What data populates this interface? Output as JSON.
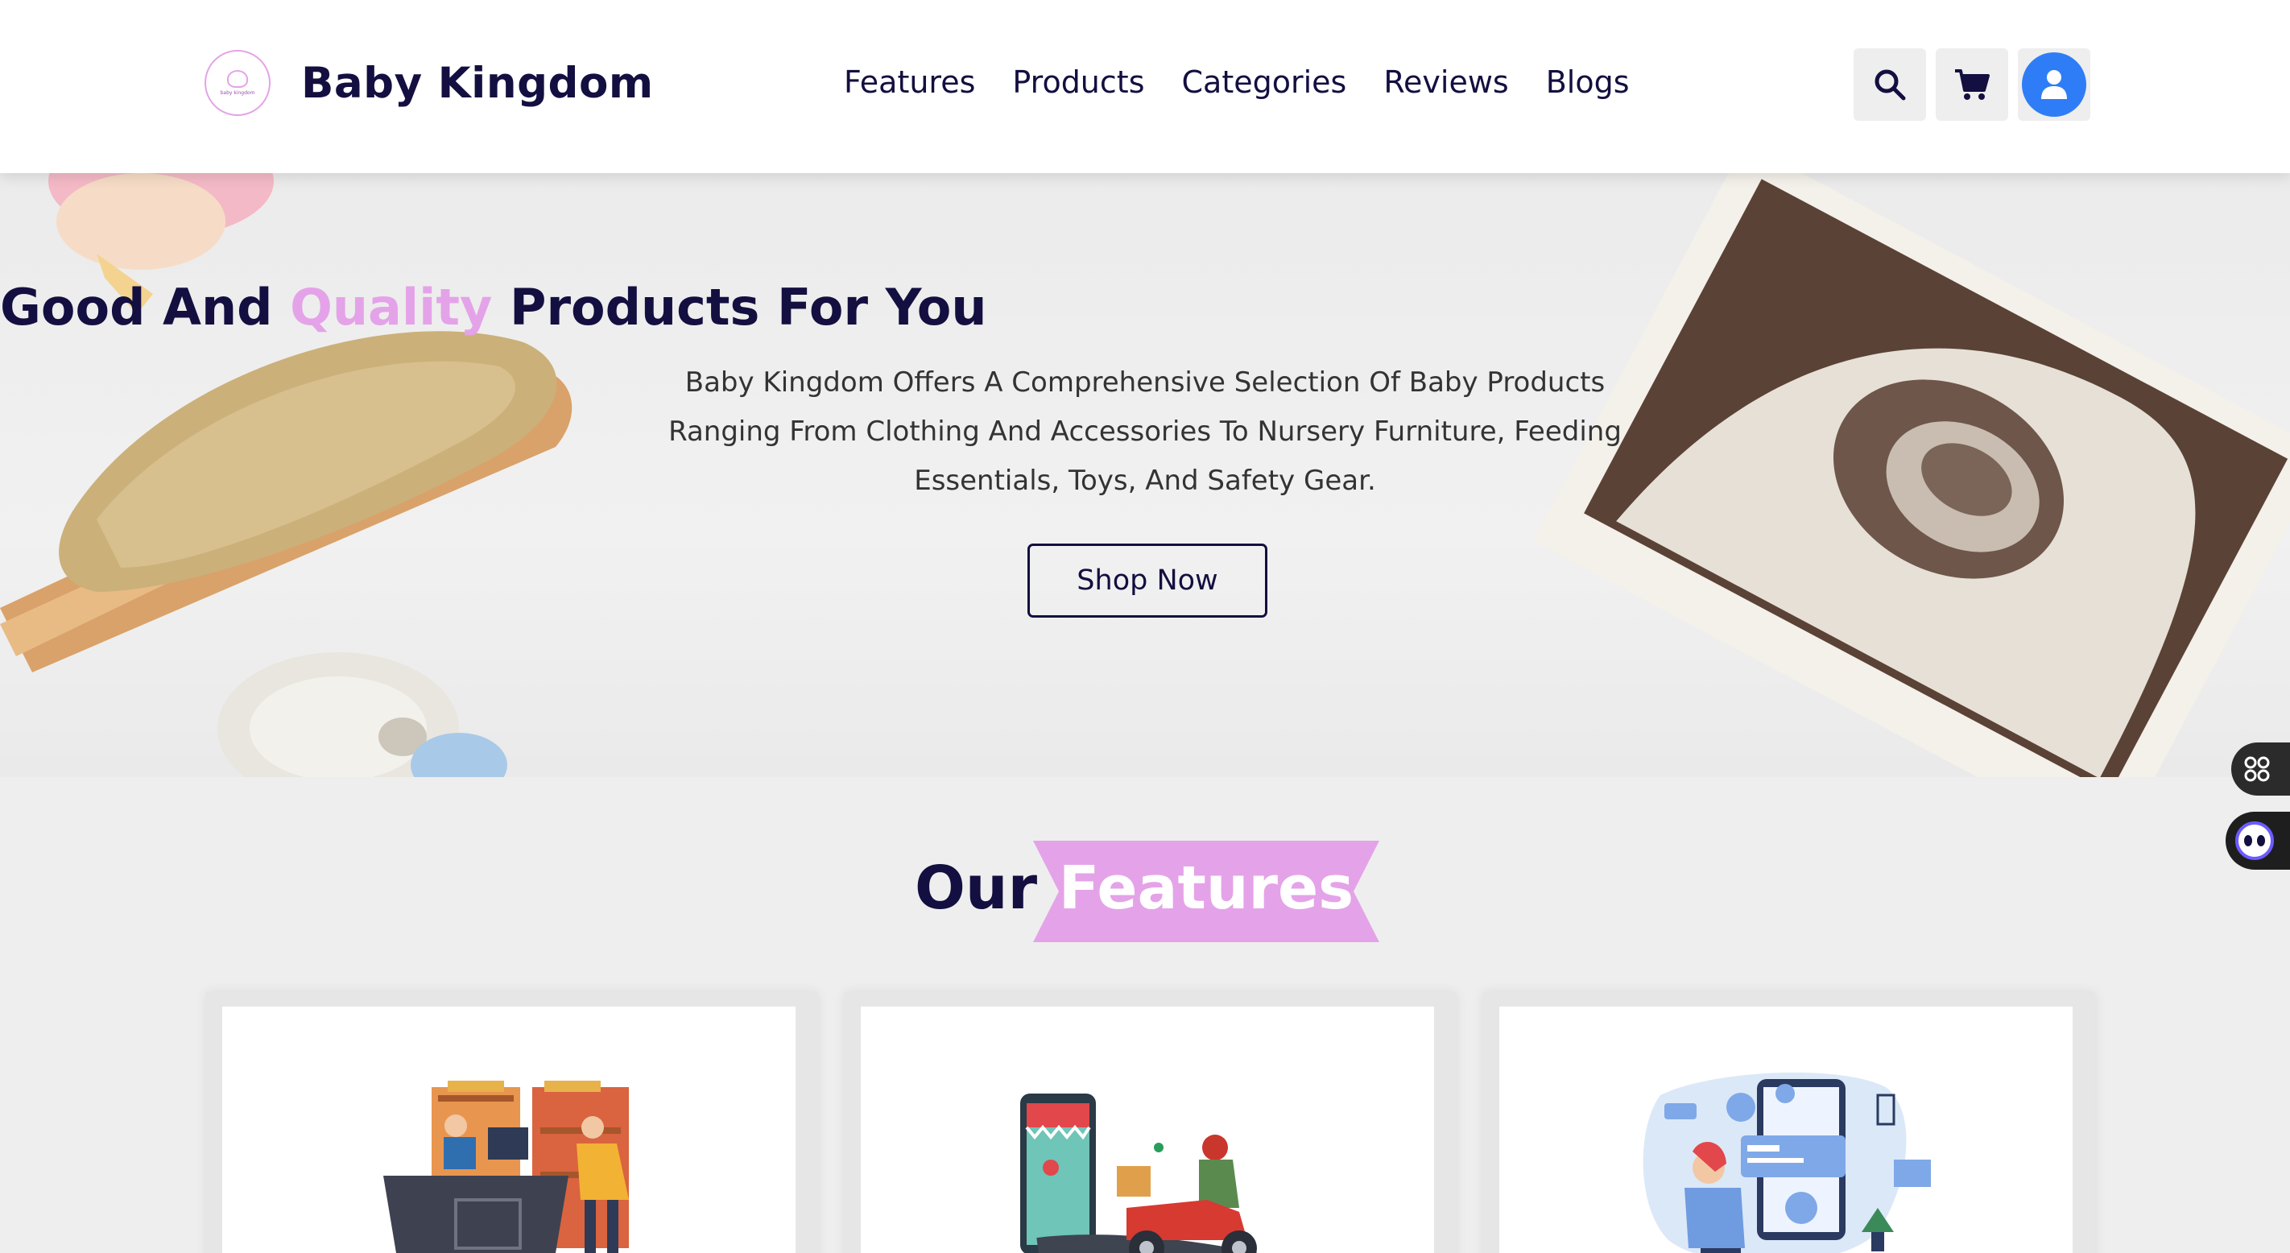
{
  "brand": {
    "name": "Baby Kingdom",
    "logo_caption": "baby kingdom"
  },
  "nav": {
    "items": [
      {
        "label": "Features"
      },
      {
        "label": "Products"
      },
      {
        "label": "Categories"
      },
      {
        "label": "Reviews"
      },
      {
        "label": "Blogs"
      }
    ]
  },
  "header_icons": {
    "search": "search-icon",
    "cart": "cart-icon",
    "user": "user-icon"
  },
  "hero": {
    "title_before": "Good And",
    "title_accent": "Quality",
    "title_after": "Products For You",
    "description": "Baby Kingdom Offers A Comprehensive Selection Of Baby Products Ranging From Clothing And Accessories To Nursery Furniture, Feeding Essentials, Toys, And Safety Gear.",
    "cta_label": "Shop Now"
  },
  "features": {
    "heading_plain": "Our",
    "heading_highlight": "Features",
    "cards": [
      {
        "illustration": "store-checkout-illustration"
      },
      {
        "illustration": "delivery-scooter-illustration"
      },
      {
        "illustration": "online-payment-illustration"
      }
    ]
  },
  "colors": {
    "primary": "#130f40",
    "accent": "#e4a3e8",
    "avatar": "#2f7df6",
    "background": "#eeeeee"
  }
}
